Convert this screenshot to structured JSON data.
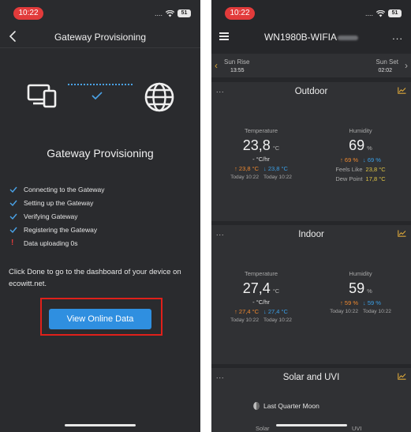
{
  "left": {
    "status": {
      "time": "10:22",
      "dots": "....",
      "battery": "51"
    },
    "nav": {
      "title": "Gateway Provisioning"
    },
    "heading": "Gateway Provisioning",
    "steps": [
      {
        "label": "Connecting to the Gateway",
        "state": "done"
      },
      {
        "label": "Setting up the Gateway",
        "state": "done"
      },
      {
        "label": "Verifying Gateway",
        "state": "done"
      },
      {
        "label": "Registering the Gateway",
        "state": "done"
      },
      {
        "label": "Data uploading 0s",
        "state": "pending"
      }
    ],
    "done_text": "Click Done to go to the dashboard of your device on ecowitt.net.",
    "button_label": "View Online Data"
  },
  "right": {
    "status": {
      "time": "10:22",
      "dots": "....",
      "battery": "51"
    },
    "header": {
      "title": "WN1980B-WIFIA",
      "more": "..."
    },
    "sun": {
      "rise_label": "Sun Rise",
      "rise_time": "13:55",
      "set_label": "Sun Set",
      "set_time": "02:02"
    },
    "outdoor": {
      "title": "Outdoor",
      "dots": "...",
      "temperature": {
        "label": "Temperature",
        "value": "23,8",
        "unit": "°C",
        "rate": "- °C/hr",
        "high": "↑ 23,8 °C",
        "low": "↓ 23,8 °C",
        "high_time": "Today 10:22",
        "low_time": "Today 10:22"
      },
      "humidity": {
        "label": "Humidity",
        "value": "69",
        "unit": "%",
        "high": "↑ 69 %",
        "low": "↓ 69 %",
        "feels_label": "Feels Like",
        "feels_value": "23,8 °C",
        "dew_label": "Dew Point",
        "dew_value": "17,8 °C"
      }
    },
    "indoor": {
      "title": "Indoor",
      "dots": "...",
      "temperature": {
        "label": "Temperature",
        "value": "27,4",
        "unit": "°C",
        "rate": "- °C/hr",
        "high": "↑ 27,4 °C",
        "low": "↓ 27,4 °C",
        "high_time": "Today 10:22",
        "low_time": "Today 10:22"
      },
      "humidity": {
        "label": "Humidity",
        "value": "59",
        "unit": "%",
        "high": "↑ 59 %",
        "low": "↓ 59 %",
        "high_time": "Today 10:22",
        "low_time": "Today 10:22"
      }
    },
    "solar": {
      "title": "Solar and UVI",
      "dots": "...",
      "moon": "Last Quarter Moon",
      "solar_label": "Solar",
      "uvi_label": "UVI"
    }
  },
  "colors": {
    "accent": "#2f8fe0",
    "check": "#4aa3e8",
    "high": "#f0892f",
    "low": "#3aa0e8",
    "highlight": "#e0201a",
    "chart_icon": "#d9a63a"
  }
}
